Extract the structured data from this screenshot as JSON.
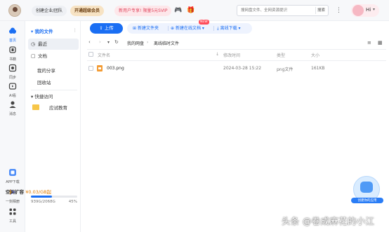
{
  "topbar": {
    "create_label": "创建企业/团队",
    "vip_label": "开通超级会员",
    "promo_label": "新用户专享! 限量5元SVIP",
    "search_placeholder": "搜网盘文件、全网资源提识",
    "search_button": "搜索",
    "hi_label": "Hi",
    "icons": [
      "game-icon",
      "gift-icon",
      "more-icon"
    ]
  },
  "rail": {
    "items": [
      {
        "label": "首页",
        "icon": "cloud-icon",
        "color": "#1a6ef3"
      },
      {
        "label": "书籍",
        "icon": "book-icon",
        "color": "#444444"
      },
      {
        "label": "同步",
        "icon": "sync-icon",
        "color": "#444444"
      },
      {
        "label": "AI看",
        "icon": "ai-icon",
        "color": "#444444"
      },
      {
        "label": "消息",
        "icon": "message-icon",
        "color": "#444444"
      }
    ],
    "bottom": [
      {
        "label": "APP下载",
        "icon": "app-download-icon"
      },
      {
        "label": "一刻相册",
        "icon": "album-icon"
      },
      {
        "label": "工具",
        "icon": "tools-icon"
      }
    ]
  },
  "sidebar": {
    "my_files": "我的文件",
    "items": [
      {
        "label": "最近",
        "icon": "clock-icon",
        "active": true
      },
      {
        "label": "文档",
        "icon": "doc-icon",
        "active": false
      }
    ],
    "my_share": "我的分享",
    "recycle": "回收站",
    "quick_access": "快捷访问",
    "quick_items": [
      {
        "label": "应试教育"
      }
    ],
    "storage": {
      "title": "空间扩容",
      "promo": "¥0.03/GB起",
      "usage": "939G/2068G",
      "percent": "45%",
      "fraction": 0.45
    }
  },
  "toolbar": {
    "upload": "上传",
    "new_folder": "新建文件夹",
    "new_online_doc": "新建在线文档",
    "offline_download": "离线下载",
    "new_badge": "NEW"
  },
  "nav": {
    "breadcrumb": [
      "我的网盘",
      "离线临时文件"
    ]
  },
  "table": {
    "headers": {
      "name": "文件名",
      "modified": "修改时间",
      "type": "类型",
      "size": "大小"
    },
    "rows": [
      {
        "name": "003.png",
        "modified": "2024-03-28 15:22",
        "type": "png文件",
        "size": "161KB"
      }
    ]
  },
  "float_widget": {
    "label": "创建你的应用"
  },
  "watermark": "头条 @卷成麻花的小江",
  "colors": {
    "accent": "#1a6ef3",
    "vip": "#f7e3c4",
    "promo": "#e0435b"
  }
}
